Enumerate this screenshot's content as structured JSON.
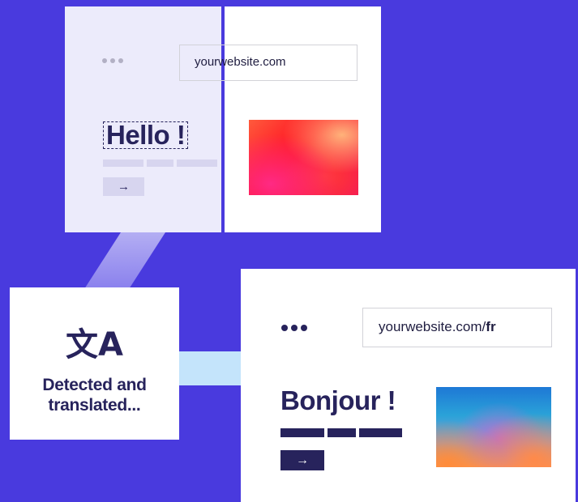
{
  "top_card": {
    "url": "yourwebsite.com",
    "heading": "Hello !",
    "arrow": "→"
  },
  "badge": {
    "icon": "translate-icon",
    "icon_glyph": "文A",
    "text_line1": "Detected and",
    "text_line2": "translated..."
  },
  "bottom_card": {
    "url_base": "yourwebsite.com/",
    "url_suffix": "fr",
    "heading": "Bonjour !",
    "arrow": "→"
  },
  "colors": {
    "background": "#493ADE",
    "text_dark": "#27235c",
    "connector_light": "#c4e4fb"
  }
}
